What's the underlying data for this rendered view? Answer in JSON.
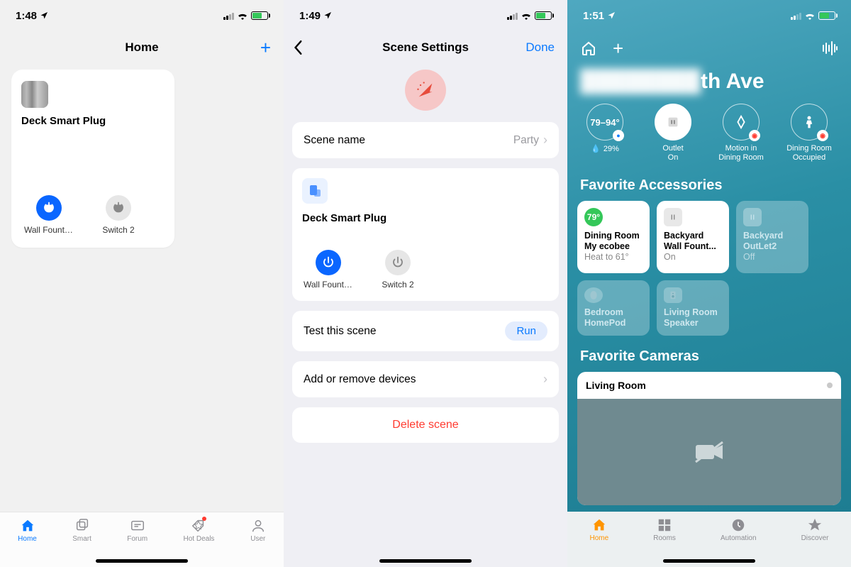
{
  "phone1": {
    "status_time": "1:48",
    "header_title": "Home",
    "device_title": "Deck Smart Plug",
    "switch1_label": "Wall Fountai...",
    "switch2_label": "Switch 2",
    "tabs": {
      "home": "Home",
      "smart": "Smart",
      "forum": "Forum",
      "hotdeals": "Hot Deals",
      "user": "User"
    }
  },
  "phone2": {
    "status_time": "1:49",
    "header_title": "Scene Settings",
    "done": "Done",
    "scene_name_label": "Scene name",
    "scene_name_value": "Party",
    "device_title": "Deck Smart Plug",
    "switch1_label": "Wall Fountai...",
    "switch2_label": "Switch 2",
    "test_label": "Test this scene",
    "run": "Run",
    "addremove": "Add or remove devices",
    "delete": "Delete scene"
  },
  "phone3": {
    "status_time": "1:51",
    "title_suffix": "th Ave",
    "temp_range": "79–94°",
    "humidity": "29%",
    "circle_outlet_l1": "Outlet",
    "circle_outlet_l2": "On",
    "circle_motion_l1": "Motion in",
    "circle_motion_l2": "Dining Room",
    "circle_dining_l1": "Dining Room",
    "circle_dining_l2": "Occupied",
    "fav_acc_h": "Favorite Accessories",
    "tile1_badge": "79°",
    "tile1_l1": "Dining Room",
    "tile1_l2": "My ecobee",
    "tile1_l3": "Heat to 61°",
    "tile2_l1": "Backyard",
    "tile2_l2": "Wall Fount...",
    "tile2_l3": "On",
    "tile3_l1": "Backyard",
    "tile3_l2": "OutLet2",
    "tile3_l3": "Off",
    "tile4_l1": "Bedroom",
    "tile4_l2": "HomePod",
    "tile5_l1": "Living Room",
    "tile5_l2": "Speaker",
    "fav_cam_h": "Favorite Cameras",
    "cam_label": "Living Room",
    "tabs": {
      "home": "Home",
      "rooms": "Rooms",
      "automation": "Automation",
      "discover": "Discover"
    }
  }
}
